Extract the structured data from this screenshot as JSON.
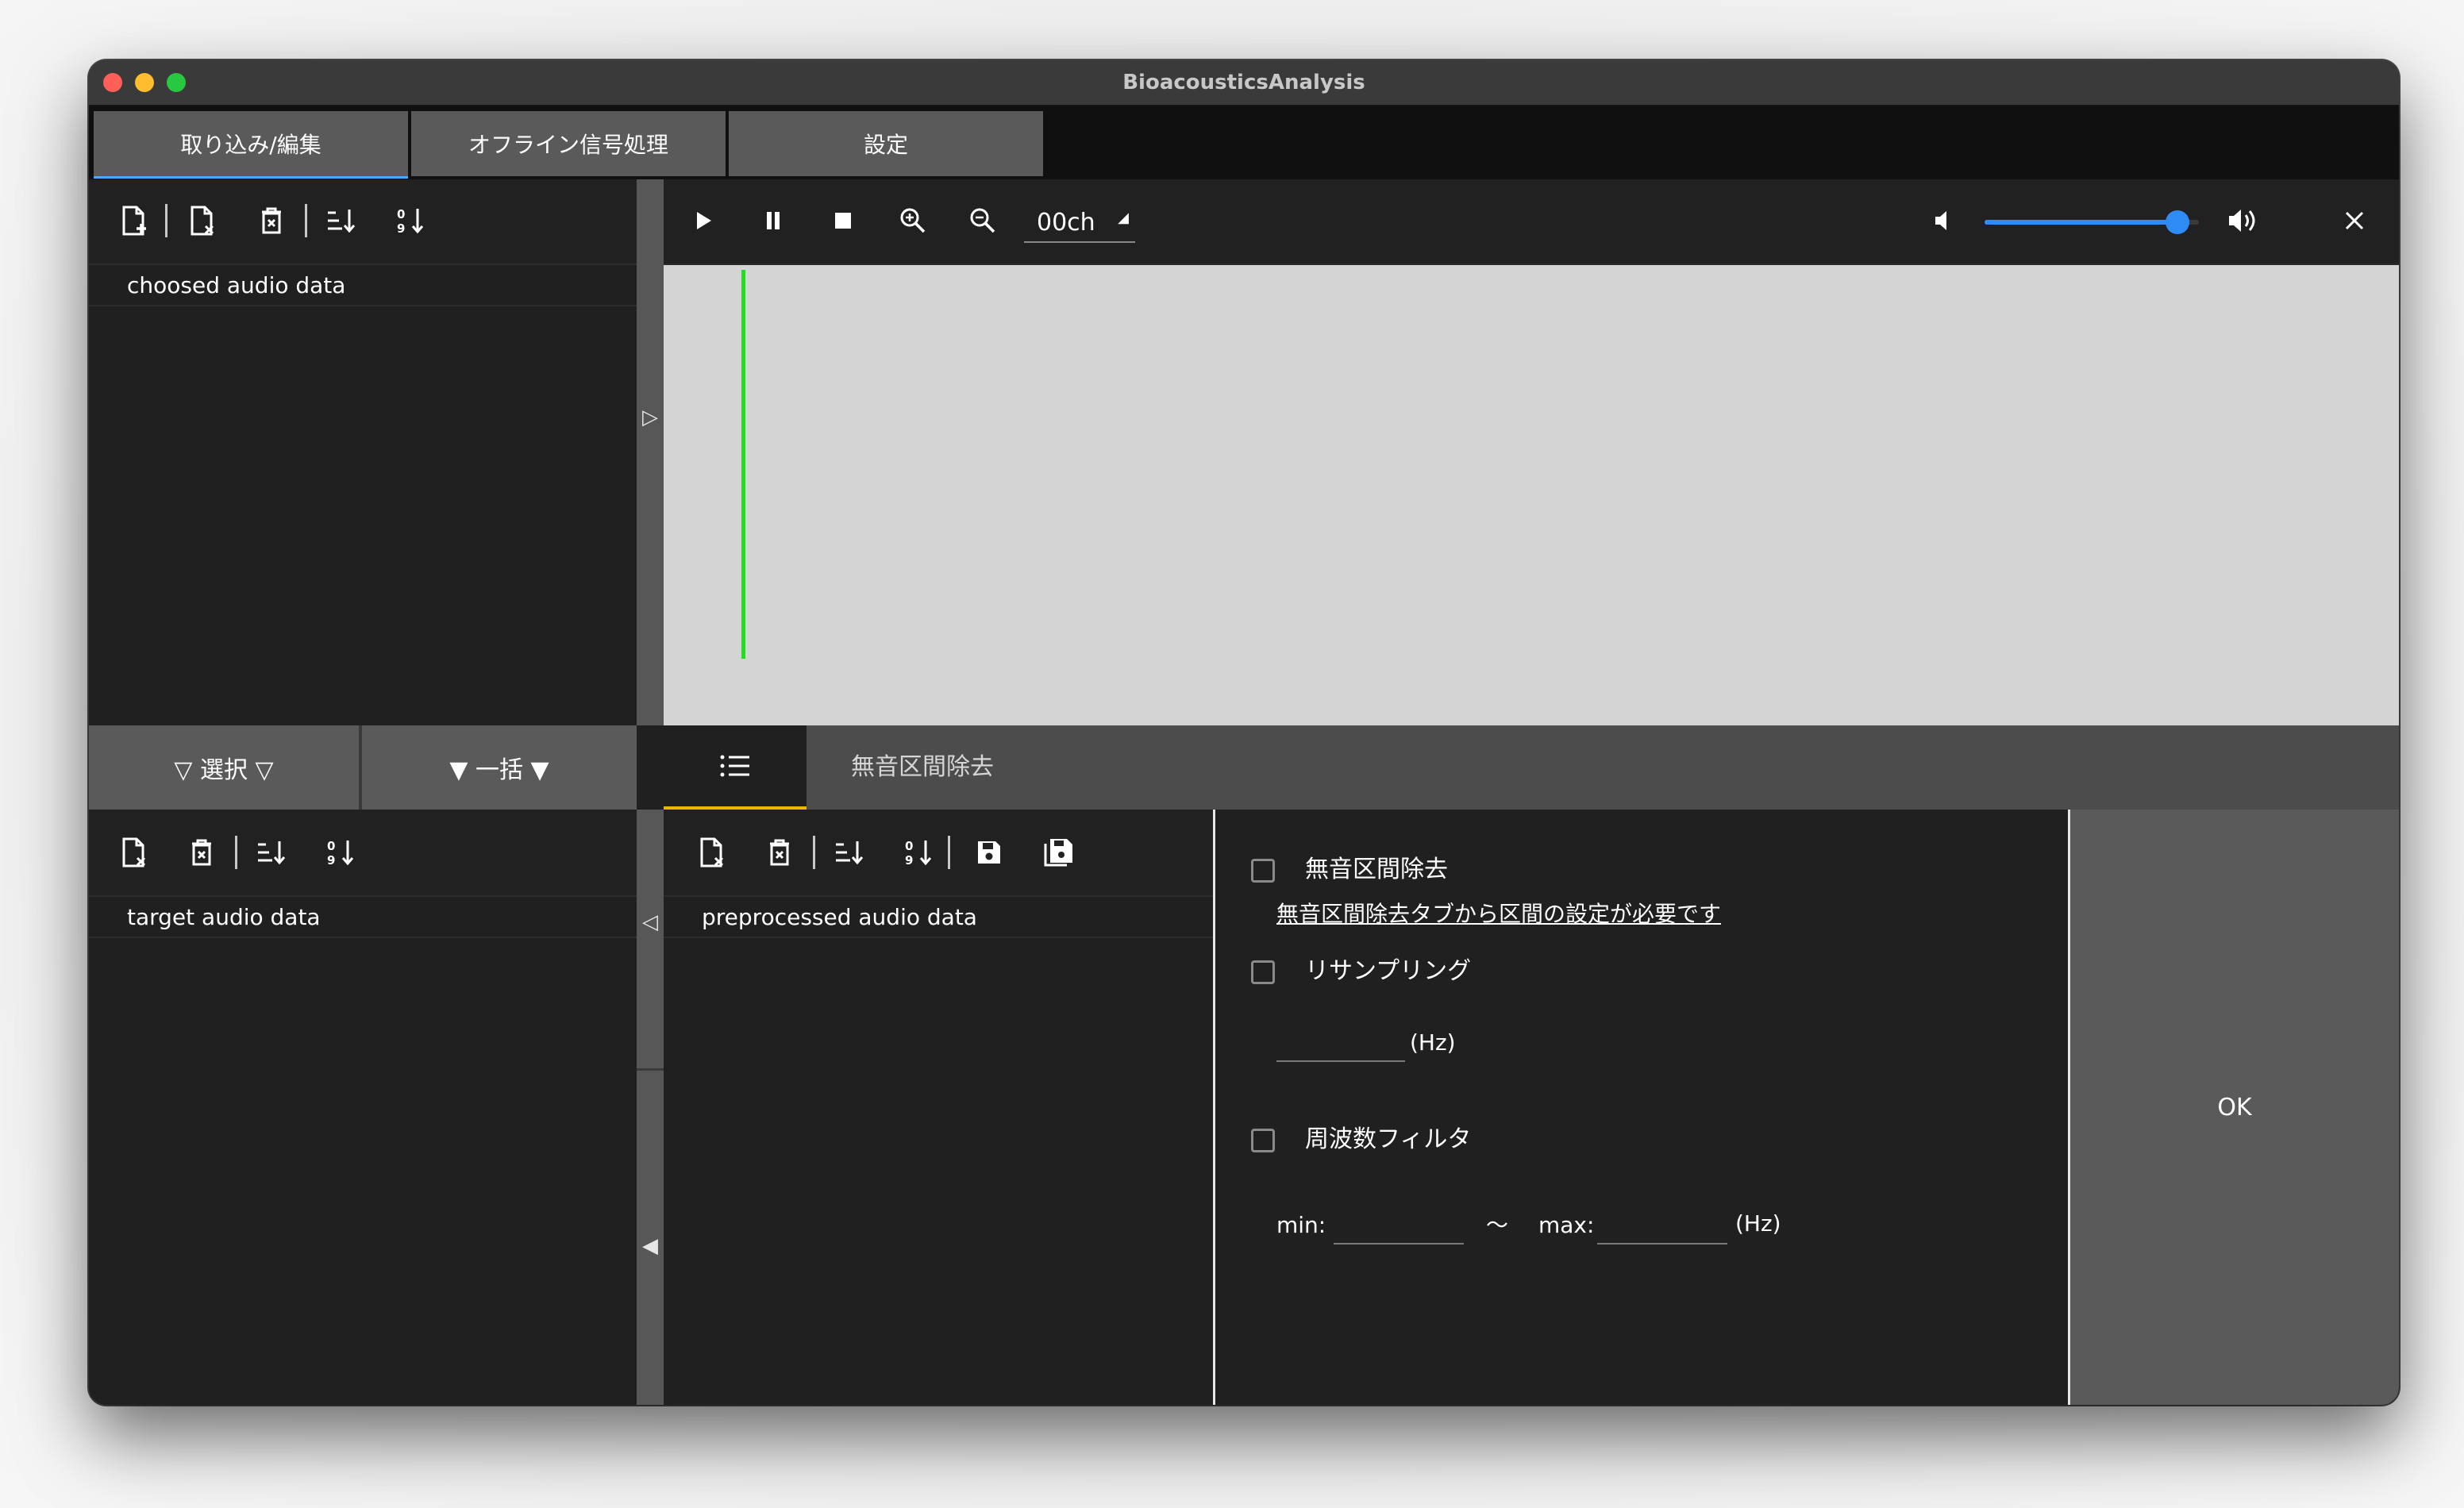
{
  "window": {
    "title": "BioacousticsAnalysis"
  },
  "main_tabs": [
    "取り込み/編集",
    "オフライン信号処理",
    "設定"
  ],
  "top_left_list": {
    "header": "choosed audio data"
  },
  "player": {
    "channel": "00ch",
    "volume_fraction": 0.95,
    "accent_color": "#2f8cf6",
    "cursor_color": "#22dd22"
  },
  "middle_buttons": {
    "select": "▽ 選択 ▽",
    "batch": "▼ 一括 ▼"
  },
  "bottom_left_list": {
    "header": "target audio data"
  },
  "bottom_mid_list": {
    "header": "preprocessed audio data"
  },
  "proc_tabs": {
    "list_icon": "list-icon",
    "silence_tab": "無音区間除去"
  },
  "options": {
    "silence_removal": {
      "label": "無音区間除去",
      "checked": false,
      "note": "無音区間除去タブから区間の設定が必要です"
    },
    "resampling": {
      "label": "リサンプリング",
      "checked": false,
      "unit": "(Hz)",
      "value": ""
    },
    "freq_filter": {
      "label": "周波数フィルタ",
      "checked": false,
      "min_label": "min:",
      "tilde": "〜",
      "max_label": "max:",
      "unit": "(Hz)",
      "min_value": "",
      "max_value": ""
    }
  },
  "ok_button": "OK",
  "collapse_arrows": {
    "top": "▷",
    "mid": "◁",
    "bottom": "◀"
  }
}
